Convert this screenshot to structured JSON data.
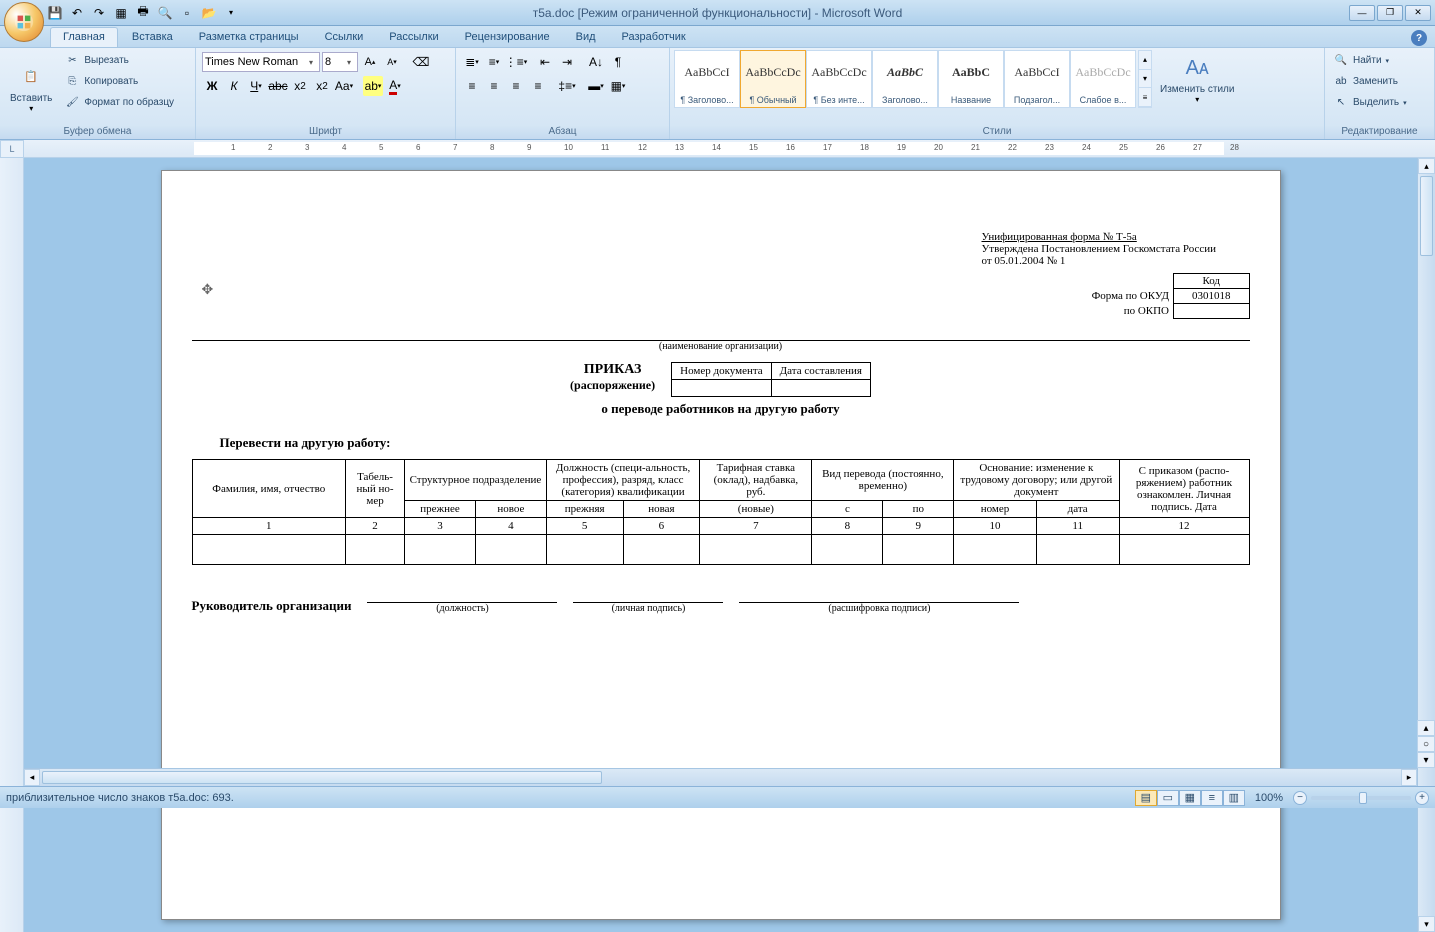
{
  "title": "т5а.doc [Режим ограниченной функциональности] - Microsoft Word",
  "tabs": [
    "Главная",
    "Вставка",
    "Разметка страницы",
    "Ссылки",
    "Рассылки",
    "Рецензирование",
    "Вид",
    "Разработчик"
  ],
  "active_tab": 0,
  "clipboard": {
    "group": "Буфер обмена",
    "paste": "Вставить",
    "cut": "Вырезать",
    "copy": "Копировать",
    "format_painter": "Формат по образцу"
  },
  "font": {
    "group": "Шрифт",
    "family": "Times New Roman",
    "size": "8"
  },
  "paragraph": {
    "group": "Абзац"
  },
  "styles": {
    "group": "Стили",
    "change": "Изменить стили",
    "items": [
      {
        "preview": "AaBbCcI",
        "name": "¶ Заголово..."
      },
      {
        "preview": "AaBbCcDc",
        "name": "¶ Обычный"
      },
      {
        "preview": "AaBbCcDc",
        "name": "¶ Без инте..."
      },
      {
        "preview": "AaBbC",
        "name": "Заголово..."
      },
      {
        "preview": "AaBbC",
        "name": "Название"
      },
      {
        "preview": "AaBbCcI",
        "name": "Подзагол..."
      },
      {
        "preview": "AaBbCcDc",
        "name": "Слабое в..."
      }
    ],
    "selected": 1
  },
  "editing": {
    "group": "Редактирование",
    "find": "Найти",
    "replace": "Заменить",
    "select": "Выделить"
  },
  "document": {
    "form_line1": "Унифицированная форма № Т-5а",
    "form_line2": "Утверждена Постановлением Госкомстата России",
    "form_line3": "от 05.01.2004 № 1",
    "code_hdr": "Код",
    "okud_label": "Форма по ОКУД",
    "okud_val": "0301018",
    "okpo_label": "по ОКПО",
    "org_caption": "(наименование организации)",
    "docnum_hdr": "Номер документа",
    "date_hdr": "Дата составления",
    "title1": "ПРИКАЗ",
    "title2": "(распоряжение)",
    "subtitle": "о переводе работников на другую работу",
    "transfer": "Перевести на другую работу:",
    "th": {
      "fio": "Фамилия, имя, отчество",
      "tab": "Табель-ный но-мер",
      "struct": "Структурное подразделение",
      "position": "Должность (специ-альность, профессия), разряд, класс (категория) квалификации",
      "rate": "Тарифная ставка (оклад), надбавка, руб.",
      "kind": "Вид перевода (постоянно, временно)",
      "basis": "Основание: изменение к трудовому договору; или другой документ",
      "sign": "С приказом (распо-ряжением) работник ознакомлен. Личная подпись. Дата",
      "prev": "прежнее",
      "new": "новое",
      "prevf": "прежняя",
      "newf": "новая",
      "rates": "(новые)",
      "from": "с",
      "to": "по",
      "num": "номер",
      "date": "дата"
    },
    "nums": [
      "1",
      "2",
      "3",
      "4",
      "5",
      "6",
      "7",
      "8",
      "9",
      "10",
      "11",
      "12"
    ],
    "sign_label": "Руководитель организации",
    "sign1": "(должность)",
    "sign2": "(личная подпись)",
    "sign3": "(расшифровка подписи)"
  },
  "status": {
    "text": "приблизительное число знаков т5а.doc: 693.",
    "zoom": "100%"
  }
}
